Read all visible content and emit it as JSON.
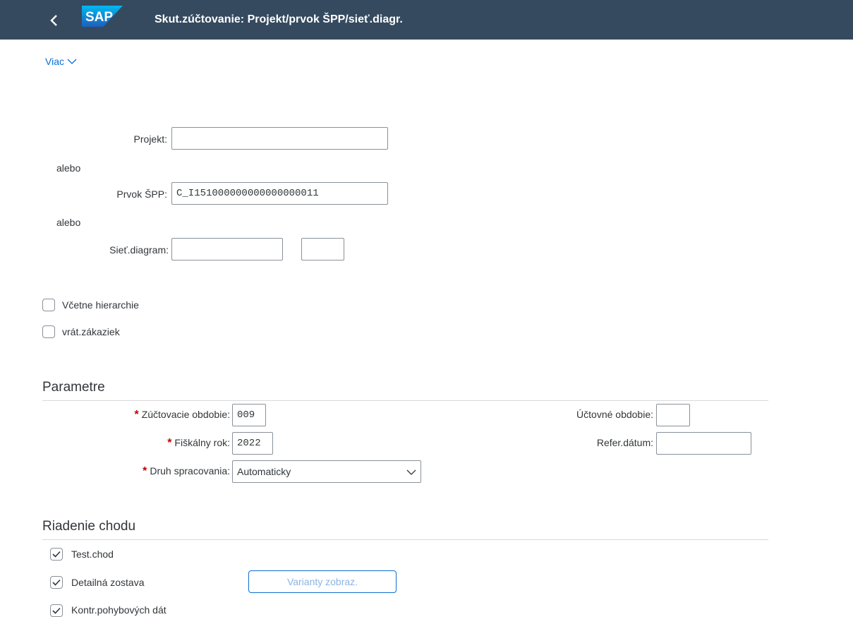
{
  "shell": {
    "title": "Skut.zúčtovanie: Projekt/prvok ŠPP/sieť.diagr.",
    "logo_text": "SAP",
    "back_icon": "chevron-left-icon"
  },
  "toolbar": {
    "more_label": "Viac"
  },
  "selection": {
    "project_label": "Projekt:",
    "project_value": "",
    "or1": "alebo",
    "wbs_label": "Prvok ŠPP:",
    "wbs_value": "C_I151000000000000000011",
    "or2": "alebo",
    "network_label": "Sieť.diagram:",
    "network_value": "",
    "network_activity_value": "",
    "hierarchy_label": "Včetne hierarchie",
    "hierarchy_checked": false,
    "orders_label": "vrát.zákaziek",
    "orders_checked": false
  },
  "parameters": {
    "heading": "Parametre",
    "settlement_period_label": "Zúčtovacie obdobie:",
    "settlement_period_value": "009",
    "posting_period_label": "Účtovné obdobie:",
    "posting_period_value": "",
    "fiscal_year_label": "Fiškálny rok:",
    "fiscal_year_value": "2022",
    "ref_date_label": "Refer.dátum:",
    "ref_date_value": "",
    "processing_type_label": "Druh spracovania:",
    "processing_type_value": "Automaticky",
    "required_marker": "*"
  },
  "run_control": {
    "heading": "Riadenie chodu",
    "test_run_label": "Test.chod",
    "test_run_checked": true,
    "detail_list_label": "Detailná zostava",
    "detail_list_checked": true,
    "layout_button_label": "Varianty zobraz.",
    "check_trans_label": "Kontr.pohybových dát",
    "check_trans_checked": true
  },
  "colors": {
    "shell_bg": "#354a5f",
    "link": "#0a6ed1",
    "required": "#bb0000",
    "text": "#32363a",
    "border": "#89919a"
  }
}
